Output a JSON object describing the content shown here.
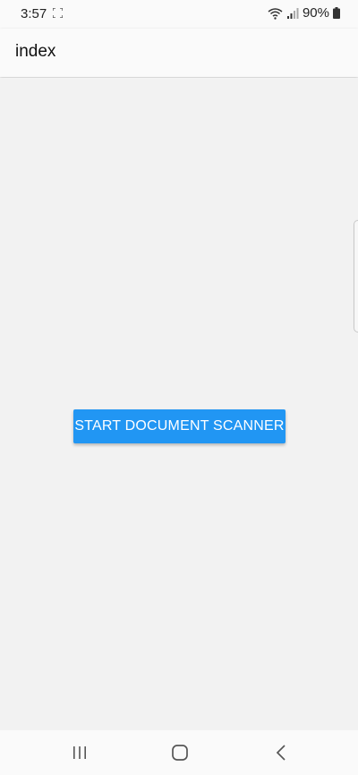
{
  "status_bar": {
    "time": "3:57",
    "battery": "90%"
  },
  "app_bar": {
    "title": "index"
  },
  "main": {
    "start_button_label": "START DOCUMENT SCANNER",
    "accent_color": "#2196f3"
  },
  "nav_bar": {
    "icons": [
      "recents-icon",
      "home-icon",
      "back-icon"
    ]
  }
}
